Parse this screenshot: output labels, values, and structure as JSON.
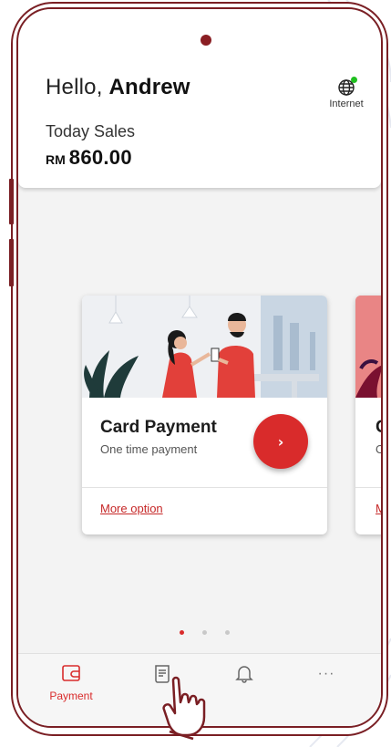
{
  "header": {
    "greeting_prefix": "Hello,",
    "user_name": "Andrew",
    "network_label": "Internet",
    "network_status_color": "#20c020",
    "sales_label": "Today Sales",
    "sales_currency": "RM",
    "sales_amount": "860.00"
  },
  "carousel": {
    "cards": [
      {
        "title": "Card Payment",
        "subtitle": "One time payment",
        "action_icon": "chevron-right-icon",
        "link_label": "More option"
      },
      {
        "title": "C",
        "subtitle": "O",
        "link_label": "M"
      }
    ],
    "pager": {
      "total": 3,
      "active_index": 0
    }
  },
  "bottom_nav": {
    "items": [
      {
        "icon": "wallet-icon",
        "label": "Payment",
        "active": true
      },
      {
        "icon": "receipt-icon",
        "label": ""
      },
      {
        "icon": "bell-icon",
        "label": ""
      },
      {
        "icon": "more-icon",
        "label": ""
      }
    ]
  },
  "colors": {
    "accent": "#d92b2b",
    "frame": "#7a1f24"
  },
  "glyphs": {
    "chevron": "›",
    "ellipsis": "···"
  }
}
